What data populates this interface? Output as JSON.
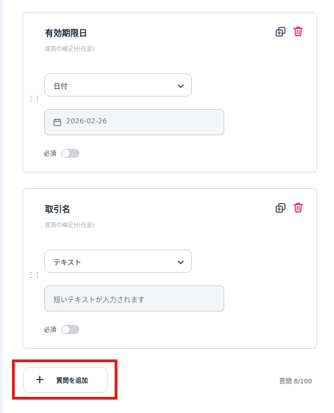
{
  "questions": [
    {
      "title": "有効期限日",
      "description_placeholder": "質問の補足分(任意)",
      "type": "日付",
      "preview": "2026-02-26",
      "preview_icon": "calendar-icon",
      "required_label": "必須",
      "required": false
    },
    {
      "title": "取引名",
      "description_placeholder": "質問の補足分(任意)",
      "type": "テキスト",
      "preview": "短いテキストが入力されます",
      "required_label": "必須",
      "required": false
    }
  ],
  "footer": {
    "add_button_label": "質問を追加",
    "question_count": "質問 8/100"
  },
  "colors": {
    "delete_icon": "#e0245e",
    "highlight": "#e0201e",
    "toggle_off": "#d1d5db"
  }
}
